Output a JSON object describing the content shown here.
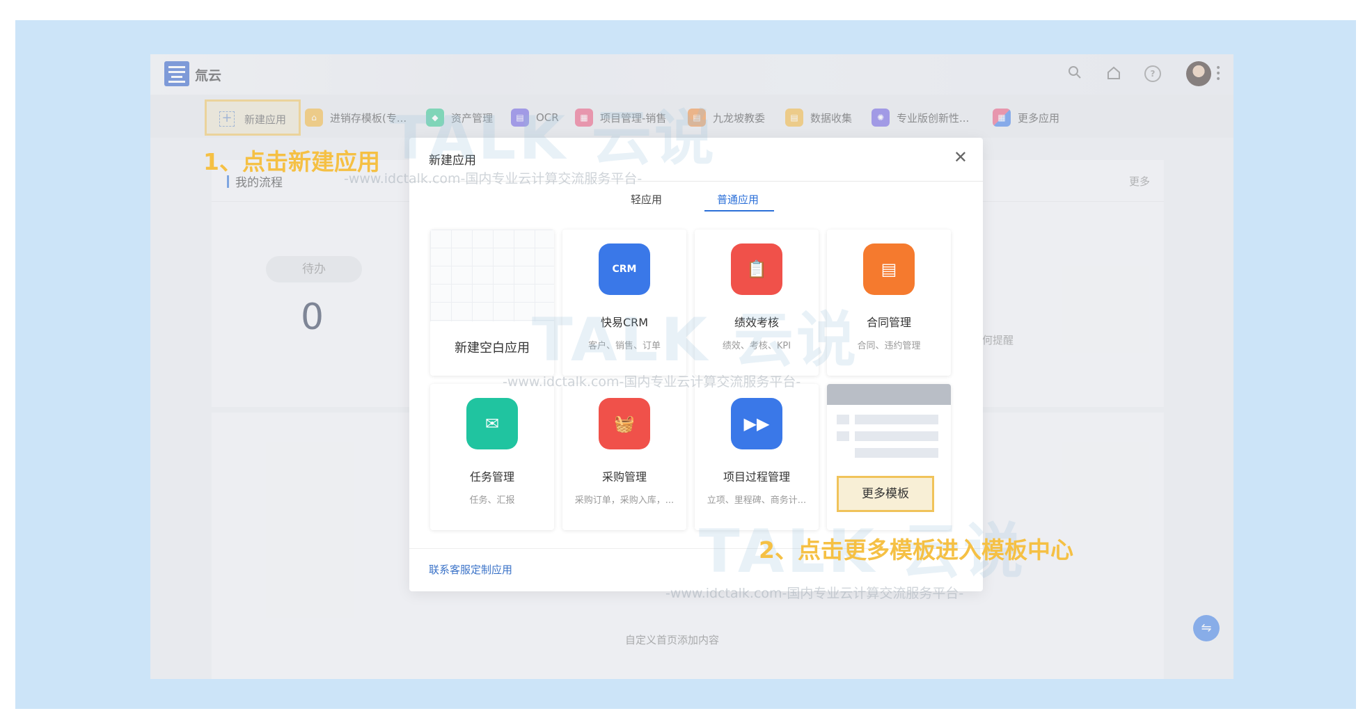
{
  "brand": {
    "name": "氚云"
  },
  "appbar": {
    "new_app_label": "新建应用",
    "shortcuts": [
      {
        "label": "进销存模板(专...",
        "color": "#f2b53a"
      },
      {
        "label": "资产管理",
        "color": "#2ec68f"
      },
      {
        "label": "OCR",
        "color": "#6b5ce0"
      },
      {
        "label": "项目管理-销售",
        "color": "#e9547a"
      },
      {
        "label": "九龙坡教委",
        "color": "#f08a3a"
      },
      {
        "label": "数据收集",
        "color": "#f2b53a"
      },
      {
        "label": "专业版创新性...",
        "color": "#6b5ce0"
      },
      {
        "label": "更多应用",
        "color": "#e9547a"
      }
    ]
  },
  "background": {
    "flow_title": "我的流程",
    "more_label": "更多",
    "todo_label": "待办",
    "todo_count": "0",
    "remind_label": "何提醒",
    "custom_msg": "自定义首页添加内容"
  },
  "dialog": {
    "title": "新建应用",
    "tabs": [
      "轻应用",
      "普通应用"
    ],
    "active_tab": "普通应用",
    "blank_label": "新建空白应用",
    "templates": [
      {
        "name": "快易CRM",
        "desc": "客户、销售、订单",
        "color": "#3a78e8"
      },
      {
        "name": "绩效考核",
        "desc": "绩效、考核、KPI",
        "color": "#f0514a"
      },
      {
        "name": "合同管理",
        "desc": "合同、违约管理",
        "color": "#f57a2e"
      },
      {
        "name": "任务管理",
        "desc": "任务、汇报",
        "color": "#20c4a0"
      },
      {
        "name": "采购管理",
        "desc": "采购订单，采购入库，...",
        "color": "#f0514a"
      },
      {
        "name": "项目过程管理",
        "desc": "立项、里程碑、商务计...",
        "color": "#3a78e8"
      }
    ],
    "more_templates_label": "更多模板",
    "contact_label": "联系客服定制应用"
  },
  "annotations": {
    "step1": "1、点击新建应用",
    "step2": "2、点击更多模板进入模板中心"
  },
  "watermark": {
    "logo_text": "TALK 云说",
    "sub_text": "-www.idctalk.com-国内专业云计算交流服务平台-"
  }
}
